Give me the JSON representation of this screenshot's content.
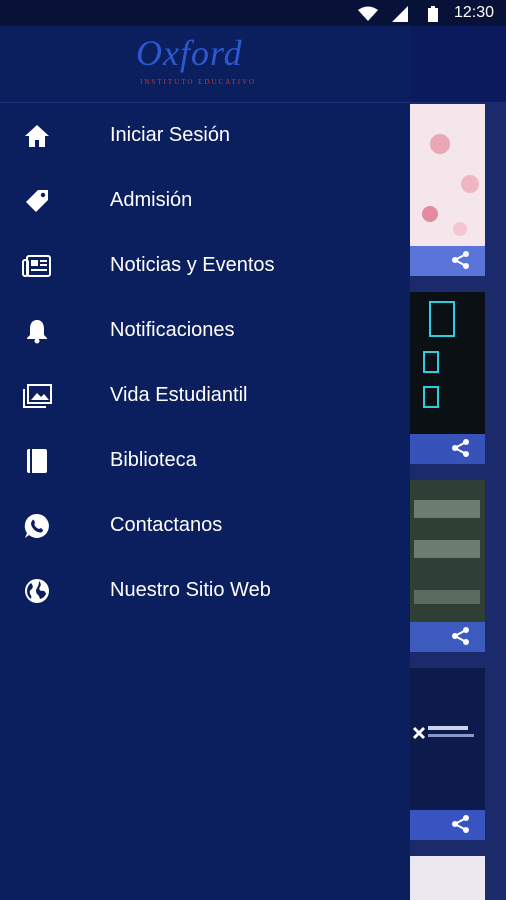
{
  "status_bar": {
    "time": "12:30"
  },
  "colors": {
    "drawer_bg": "#0b1f5e",
    "status_bg": "#081239",
    "accent": "#3f5fd6"
  },
  "logo": {
    "text": "Oxford",
    "subtitle": "INSTITUTO EDUCATIVO"
  },
  "menu": {
    "items": [
      {
        "label": "Iniciar Sesión",
        "icon": "home-icon"
      },
      {
        "label": "Admisión",
        "icon": "tag-icon"
      },
      {
        "label": "Noticias y Eventos",
        "icon": "newspaper-icon"
      },
      {
        "label": "Notificaciones",
        "icon": "bell-icon"
      },
      {
        "label": "Vida Estudiantil",
        "icon": "photo-gallery-icon"
      },
      {
        "label": "Biblioteca",
        "icon": "book-icon"
      },
      {
        "label": "Contactanos",
        "icon": "whatsapp-icon"
      },
      {
        "label": "Nuestro Sitio Web",
        "icon": "globe-icon"
      }
    ]
  },
  "background_cards": [
    {
      "icon": "share-icon"
    },
    {
      "icon": "share-icon"
    },
    {
      "icon": "share-icon"
    },
    {
      "icon": "share-icon"
    }
  ]
}
